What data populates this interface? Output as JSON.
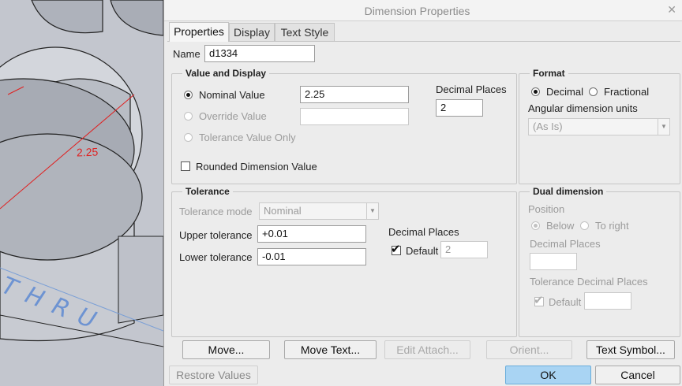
{
  "dialog": {
    "title": "Dimension Properties",
    "close_glyph": "✕",
    "tabs": [
      {
        "label": "Properties",
        "active": true
      },
      {
        "label": "Display",
        "active": false
      },
      {
        "label": "Text Style",
        "active": false
      }
    ],
    "name_label": "Name",
    "name_value": "d1334",
    "value_display": {
      "title": "Value and Display",
      "options": [
        {
          "label": "Nominal Value",
          "selected": true,
          "enabled": true
        },
        {
          "label": "Override Value",
          "selected": false,
          "enabled": false
        },
        {
          "label": "Tolerance Value Only",
          "selected": false,
          "enabled": false
        }
      ],
      "nominal_value": "2.25",
      "override_value": "",
      "decimal_places_label": "Decimal Places",
      "decimal_places_value": "2",
      "rounded_label": "Rounded Dimension Value",
      "rounded_checked": false
    },
    "format": {
      "title": "Format",
      "decimal_label": "Decimal",
      "fractional_label": "Fractional",
      "selected": "Decimal",
      "angular_label": "Angular dimension units",
      "angular_value": "(As Is)"
    },
    "tolerance": {
      "title": "Tolerance",
      "mode_label": "Tolerance mode",
      "mode_value": "Nominal",
      "upper_label": "Upper tolerance",
      "upper_value": "+0.01",
      "lower_label": "Lower tolerance",
      "lower_value": "-0.01",
      "decimal_places_label": "Decimal Places",
      "default_label": "Default",
      "default_checked": true,
      "decimal_value": "2"
    },
    "dual": {
      "title": "Dual dimension",
      "position_label": "Position",
      "below_label": "Below",
      "to_right_label": "To right",
      "position_selected": "Below",
      "decimal_places_label": "Decimal Places",
      "decimal_value": "",
      "tolerance_decimal_label": "Tolerance Decimal Places",
      "default_label": "Default",
      "default_checked": true,
      "tolerance_decimal_value": ""
    },
    "buttons": {
      "move": "Move...",
      "move_text": "Move Text...",
      "edit_attach": "Edit Attach...",
      "orient": "Orient...",
      "text_symbol": "Text Symbol...",
      "restore": "Restore Values",
      "ok": "OK",
      "cancel": "Cancel"
    }
  },
  "cad_view": {
    "dimension_label": "2.25",
    "thru_text": "THRU",
    "accent_color": "#e02020"
  }
}
